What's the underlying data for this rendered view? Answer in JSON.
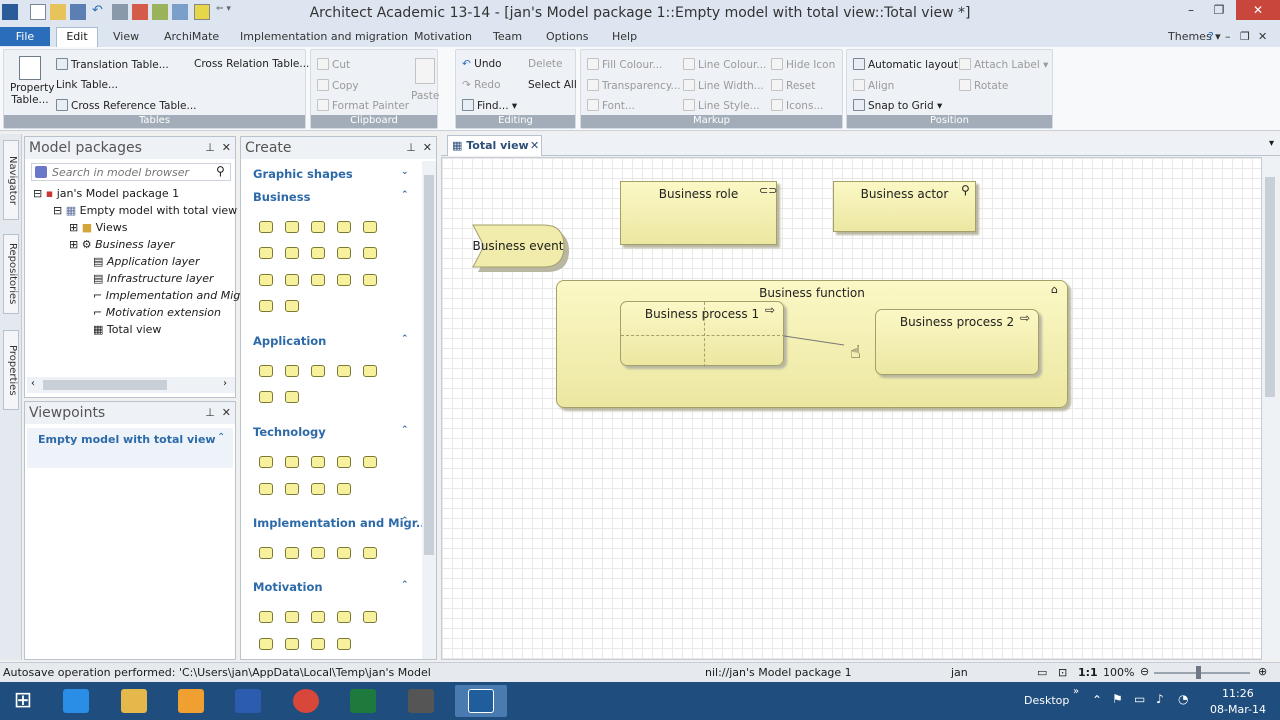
{
  "window": {
    "title": "Architect Academic 13-14 - [jan's Model package 1::Empty model with total view::Total view *]",
    "themes_label": "Themes"
  },
  "menu": {
    "tabs": [
      "File",
      "Edit",
      "View",
      "ArchiMate",
      "Implementation and migration",
      "Motivation",
      "Team",
      "Options",
      "Help"
    ]
  },
  "ribbon": {
    "tables": {
      "property_table": "Property Table...",
      "translation_table": "Translation Table...",
      "cross_relation_table": "Cross Relation Table...",
      "link_table": "Link Table...",
      "cross_reference_table": "Cross Reference Table...",
      "label": "Tables"
    },
    "clipboard": {
      "cut": "Cut",
      "copy": "Copy",
      "format_painter": "Format Painter",
      "paste": "Paste",
      "label": "Clipboard"
    },
    "editing": {
      "undo": "Undo",
      "delete": "Delete",
      "redo": "Redo",
      "select_all": "Select All",
      "find": "Find...",
      "label": "Editing"
    },
    "markup": {
      "fill_colour": "Fill Colour...",
      "line_colour": "Line Colour...",
      "hide_icon": "Hide Icon",
      "transparency": "Transparency...",
      "line_width": "Line Width...",
      "reset": "Reset",
      "font": "Font...",
      "line_style": "Line Style...",
      "icons": "Icons...",
      "label": "Markup"
    },
    "position": {
      "automatic_layout": "Automatic layout",
      "attach_label": "Attach Label",
      "align": "Align",
      "rotate": "Rotate",
      "snap_to_grid": "Snap to Grid",
      "label": "Position"
    }
  },
  "side_tabs": [
    "Navigator",
    "Repositories",
    "Properties"
  ],
  "model_packages": {
    "title": "Model packages",
    "search_placeholder": "Search in model browser",
    "tree": {
      "root": "jan's Model package 1",
      "model": "Empty model with total view",
      "views": "Views",
      "business_layer": "Business layer",
      "application_layer": "Application layer",
      "infrastructure_layer": "Infrastructure layer",
      "implementation": "Implementation and Mig",
      "motivation_extension": "Motivation extension",
      "total_view": "Total view"
    }
  },
  "viewpoints": {
    "title": "Viewpoints",
    "item": "Empty model with total view"
  },
  "create": {
    "title": "Create",
    "sections": {
      "graphic_shapes": "Graphic shapes",
      "business": "Business",
      "application": "Application",
      "technology": "Technology",
      "implementation": "Implementation and Migr...",
      "motivation": "Motivation"
    }
  },
  "document": {
    "tab": "Total view"
  },
  "diagram": {
    "business_role": "Business role",
    "business_actor": "Business actor",
    "business_event": "Business event",
    "business_function": "Business function",
    "business_process_1": "Business process 1",
    "business_process_2": "Business process 2"
  },
  "status": {
    "message": "Autosave operation performed: 'C:\\Users\\jan\\AppData\\Local\\Temp\\jan's Model packa",
    "location": "nil://jan's Model package 1",
    "user": "jan",
    "zoom": "100%"
  },
  "taskbar": {
    "desktop_label": "Desktop",
    "time": "11:26",
    "date": "08-Mar-14"
  },
  "colors": {
    "element_fill": "#f3efa8",
    "file_tab": "#2a6ebb",
    "taskbar": "#1f4d7d"
  }
}
